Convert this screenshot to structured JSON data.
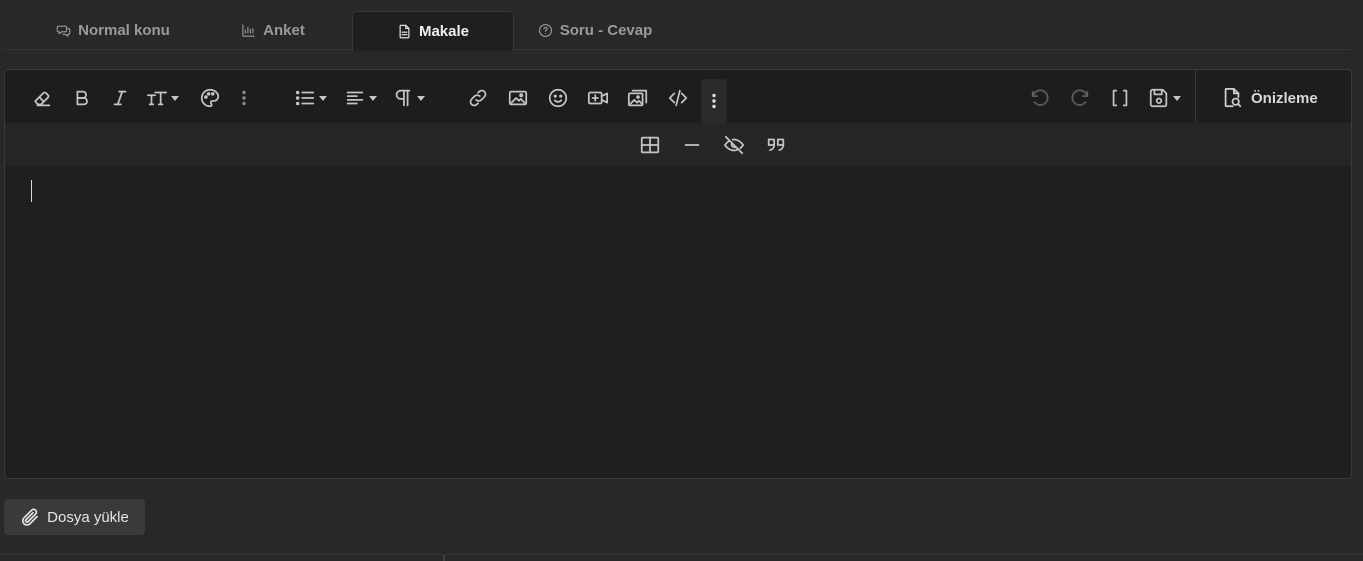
{
  "tabs": [
    {
      "label": "Normal konu",
      "icon": "chat-bubbles-icon",
      "active": false
    },
    {
      "label": "Anket",
      "icon": "bar-chart-icon",
      "active": false
    },
    {
      "label": "Makale",
      "icon": "document-icon",
      "active": true
    },
    {
      "label": "Soru - Cevap",
      "icon": "question-circle-icon",
      "active": false
    }
  ],
  "toolbar": {
    "preview_label": "Önizleme",
    "main_icons": [
      "eraser-icon",
      "bold-icon",
      "italic-icon",
      "text-size-icon",
      "palette-icon",
      "more-vertical-icon",
      "list-icon",
      "align-icon",
      "paragraph-icon",
      "link-icon",
      "image-icon",
      "smiley-icon",
      "video-add-icon",
      "gallery-icon",
      "code-icon",
      "more-vertical-icon",
      "undo-icon",
      "redo-icon",
      "brackets-icon",
      "save-draft-icon",
      "preview-icon"
    ],
    "sub_icons": [
      "table-icon",
      "horizontal-rule-icon",
      "spoiler-eye-off-icon",
      "quote-icon"
    ]
  },
  "editor": {
    "content": ""
  },
  "upload": {
    "label": "Dosya yükle"
  },
  "colors": {
    "background": "#282828",
    "editor_bg": "#1f1f1f",
    "toolbar_sub_bg": "#262626",
    "icon": "#c4c4c4",
    "upload_bg": "#3a3a3a"
  }
}
